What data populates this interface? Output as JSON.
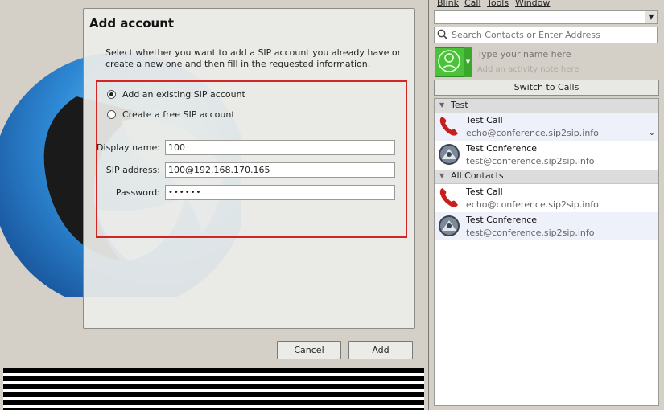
{
  "wizard": {
    "title": "Add account",
    "description": "Select whether you want to add a SIP account you already have or create a new one and then fill in the requested information.",
    "options": [
      {
        "label": "Add an existing SIP account",
        "checked": true
      },
      {
        "label": "Create a free SIP account",
        "checked": false
      }
    ],
    "form": {
      "display_name_label": "Display name:",
      "display_name_value": "100",
      "sip_address_label": "SIP address:",
      "sip_address_value": "100@192.168.170.165",
      "password_label": "Password:",
      "password_value": "••••••"
    },
    "cancel_label": "Cancel",
    "add_label": "Add"
  },
  "blink": {
    "menu": [
      "Blink",
      "Call",
      "Tools",
      "Window"
    ],
    "search_placeholder": "Search Contacts or Enter Address",
    "name_placeholder": "Type your name here",
    "activity_placeholder": "Add an activity note here",
    "switch_label": "Switch to Calls",
    "groups": [
      {
        "name": "Test",
        "contacts": [
          {
            "name": "Test Call",
            "uri": "echo@conference.sip2sip.info",
            "icon": "phone-icon"
          },
          {
            "name": "Test Conference",
            "uri": "test@conference.sip2sip.info",
            "icon": "conference-icon"
          }
        ]
      },
      {
        "name": "All Contacts",
        "contacts": [
          {
            "name": "Test Call",
            "uri": "echo@conference.sip2sip.info",
            "icon": "phone-icon"
          },
          {
            "name": "Test Conference",
            "uri": "test@conference.sip2sip.info",
            "icon": "conference-icon"
          }
        ]
      }
    ]
  },
  "colors": {
    "highlight": "#d42525",
    "avatar_green": "#4bc23a",
    "phone_red": "#c81e1e"
  }
}
